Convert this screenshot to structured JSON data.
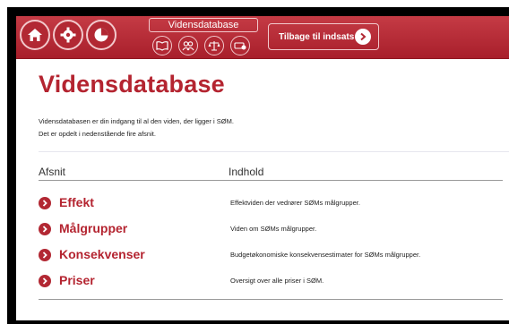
{
  "toolbar": {
    "buttons": [
      {
        "icon": "home-icon"
      },
      {
        "icon": "gear-icon"
      },
      {
        "icon": "pie-chart-icon"
      }
    ],
    "database_label": "Vidensdatabase",
    "mini_buttons": [
      {
        "icon": "book-icon"
      },
      {
        "icon": "people-icon"
      },
      {
        "icon": "scales-icon"
      },
      {
        "icon": "price-icon"
      }
    ],
    "back_label": "Tilbage til indsats"
  },
  "page": {
    "title": "Vidensdatabase",
    "intro_line1": "Vidensdatabasen er din indgang til al den viden, der ligger i SØM.",
    "intro_line2": "Det er opdelt i nedenstående fire afsnit."
  },
  "table": {
    "headers": {
      "section": "Afsnit",
      "content": "Indhold"
    },
    "rows": [
      {
        "name": "Effekt",
        "description": "Effektviden der vedrører SØMs målgrupper."
      },
      {
        "name": "Målgrupper",
        "description": "Viden om SØMs målgrupper."
      },
      {
        "name": "Konsekvenser",
        "description": "Budgetøkonomiske konsekvensestimater for SØMs målgrupper."
      },
      {
        "name": "Priser",
        "description": "Oversigt over alle priser i SØM."
      }
    ]
  },
  "colors": {
    "accent": "#b42430",
    "toolbar": "#b22833"
  }
}
